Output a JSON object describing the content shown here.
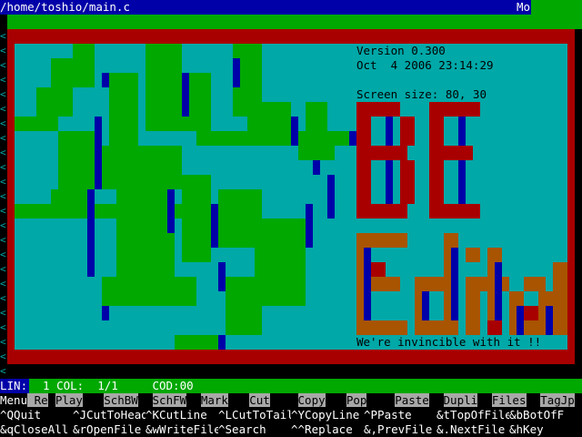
{
  "title_bar": {
    "file_path": "/home/toshio/main.c",
    "mode_indicator": "Mo"
  },
  "splash": {
    "version": "Version 0.300",
    "build_date": "Oct  4 2006 23:14:29",
    "screen_size": "Screen size: 80, 30",
    "tagline": "We're invincible with it !!"
  },
  "status": {
    "lin_label": "LIN:",
    "position_text": "  1 COL:  1/1     COD:00"
  },
  "function_keys": [
    {
      "key": "Menu",
      "label": " Rec"
    },
    {
      "key": " ",
      "label": "Play"
    },
    {
      "key": " ",
      "label": "SchBW"
    },
    {
      "key": " ",
      "label": "SchFW"
    },
    {
      "key": " ",
      "label": "Mark"
    },
    {
      "key": " ",
      "label": "Cut"
    },
    {
      "key": " ",
      "label": "Copy"
    },
    {
      "key": " ",
      "label": "Pop"
    },
    {
      "key": " ",
      "label": "Paste"
    },
    {
      "key": " ",
      "label": "Dupli"
    },
    {
      "key": " ",
      "label": "Files"
    },
    {
      "key": " ",
      "label": "TagJp"
    }
  ],
  "ctrl_keys_row1": [
    "^QQuit",
    "^JCutToHead",
    "^KCutLine",
    "^LCutToTail",
    "^YCopyLine",
    "^PPaste",
    "&tTopOfFile",
    "&bBotOfF"
  ],
  "ctrl_keys_row2": [
    "&qCloseAll",
    "&rOpenFile",
    "&wWriteFile",
    "^Search",
    "^^Replace",
    "&,PrevFile",
    "&.NextFile",
    "&hKey"
  ],
  "colors": {
    "blue": "#0000a8",
    "green": "#00a800",
    "cyan": "#00a8a8",
    "red": "#a80000",
    "brown": "#a85400",
    "gray": "#a8a8a8"
  }
}
